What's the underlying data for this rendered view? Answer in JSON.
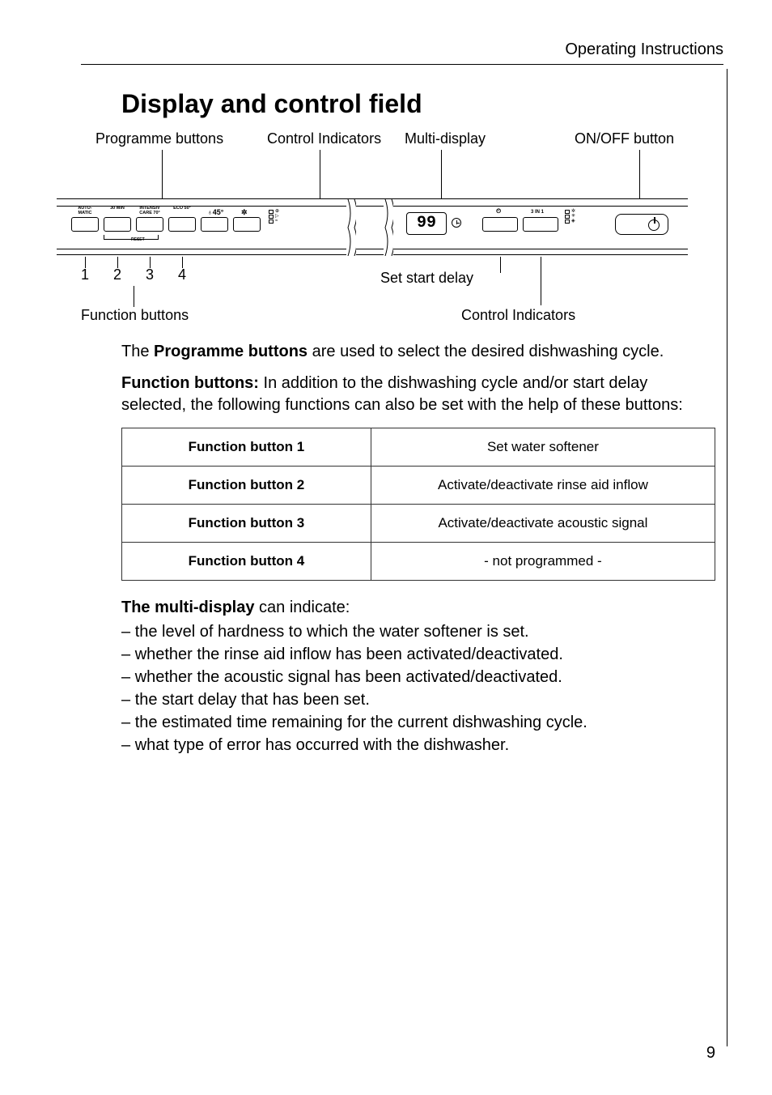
{
  "header": {
    "section": "Operating Instructions"
  },
  "title": "Display and control field",
  "labels": {
    "top_programme": "Programme buttons",
    "top_control_ind": "Control Indicators",
    "top_multi": "Multi-display",
    "top_onoff": "ON/OFF button",
    "bot_function": "Function buttons",
    "bot_delay": "Set start delay",
    "bot_control_ind": "Control Indicators",
    "nums": [
      "1",
      "2",
      "3",
      "4"
    ]
  },
  "panel": {
    "prog_btn_labels": [
      "AUTO-\nMATIC",
      "30 MIN",
      "INTENSIV\nCARE 70°",
      "ECO\n50°"
    ],
    "reset": "RESET",
    "display_value": "99",
    "delay_small": "3 IN 1"
  },
  "body": {
    "p1_a": "The ",
    "p1_b": "Programme buttons",
    "p1_c": " are used to select the desired dishwashing cycle.",
    "p2_a": "Function buttons:",
    "p2_b": " In addition to the dishwashing cycle and/or start delay selected, the following functions can also be set with the help of these buttons:"
  },
  "func_table": [
    {
      "name": "Function button 1",
      "desc": "Set water softener"
    },
    {
      "name": "Function button 2",
      "desc": "Activate/deactivate rinse aid inflow"
    },
    {
      "name": "Function button 3",
      "desc": "Activate/deactivate acoustic signal"
    },
    {
      "name": "Function button 4",
      "desc": "- not programmed -"
    }
  ],
  "multi": {
    "intro_a": "The multi-display",
    "intro_b": " can indicate:",
    "items": [
      "the level of hardness to which the water softener is set.",
      "whether the rinse aid inflow has been activated/deactivated.",
      "whether the acoustic signal has been activated/deactivated.",
      "the start delay that has been set.",
      "the estimated time remaining for the current dishwashing cycle.",
      "what type of error has occurred with the dishwasher."
    ]
  },
  "page_number": "9"
}
